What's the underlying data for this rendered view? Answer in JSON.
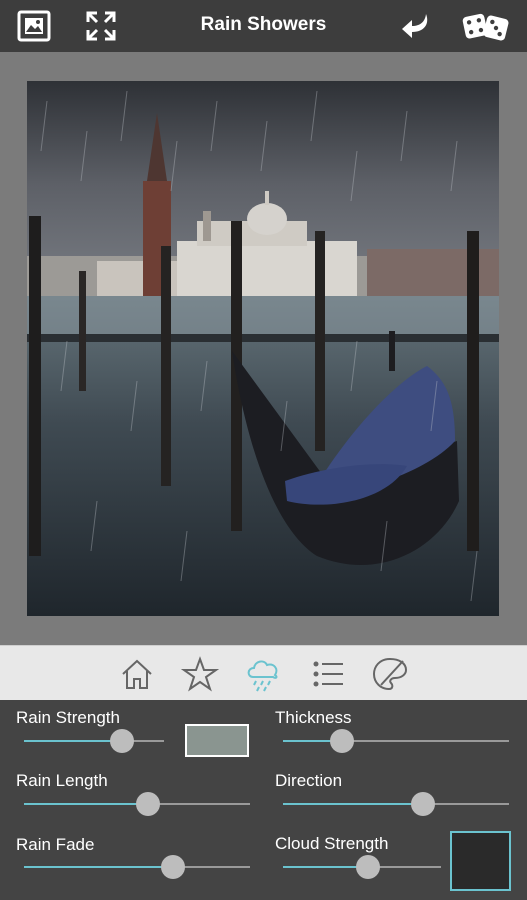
{
  "header": {
    "title": "Rain Showers",
    "icons": [
      "image-picture-icon",
      "fullscreen-expand-icon",
      "undo-arrow-icon",
      "dice-random-icon"
    ]
  },
  "tabs": [
    {
      "icon": "home-icon",
      "active": false
    },
    {
      "icon": "star-icon",
      "active": false
    },
    {
      "icon": "rain-cloud-icon",
      "active": true
    },
    {
      "icon": "list-icon",
      "active": false
    },
    {
      "icon": "paint-palette-icon",
      "active": false
    }
  ],
  "controls": {
    "rain_strength": {
      "label": "Rain Strength",
      "value": 0.7
    },
    "thickness": {
      "label": "Thickness",
      "value": 0.26
    },
    "rain_length": {
      "label": "Rain Length",
      "value": 0.55
    },
    "direction": {
      "label": "Direction",
      "value": 0.62
    },
    "rain_fade": {
      "label": "Rain Fade",
      "value": 0.66
    },
    "cloud_strength": {
      "label": "Cloud Strength",
      "value": 0.54
    }
  },
  "colors": {
    "accent": "#6bc3cf",
    "header_bg": "#3d3d3d",
    "panel_bg": "#444444",
    "rain_color_swatch": "#8a9590",
    "cloud_color_swatch": "#2a2a2a"
  }
}
